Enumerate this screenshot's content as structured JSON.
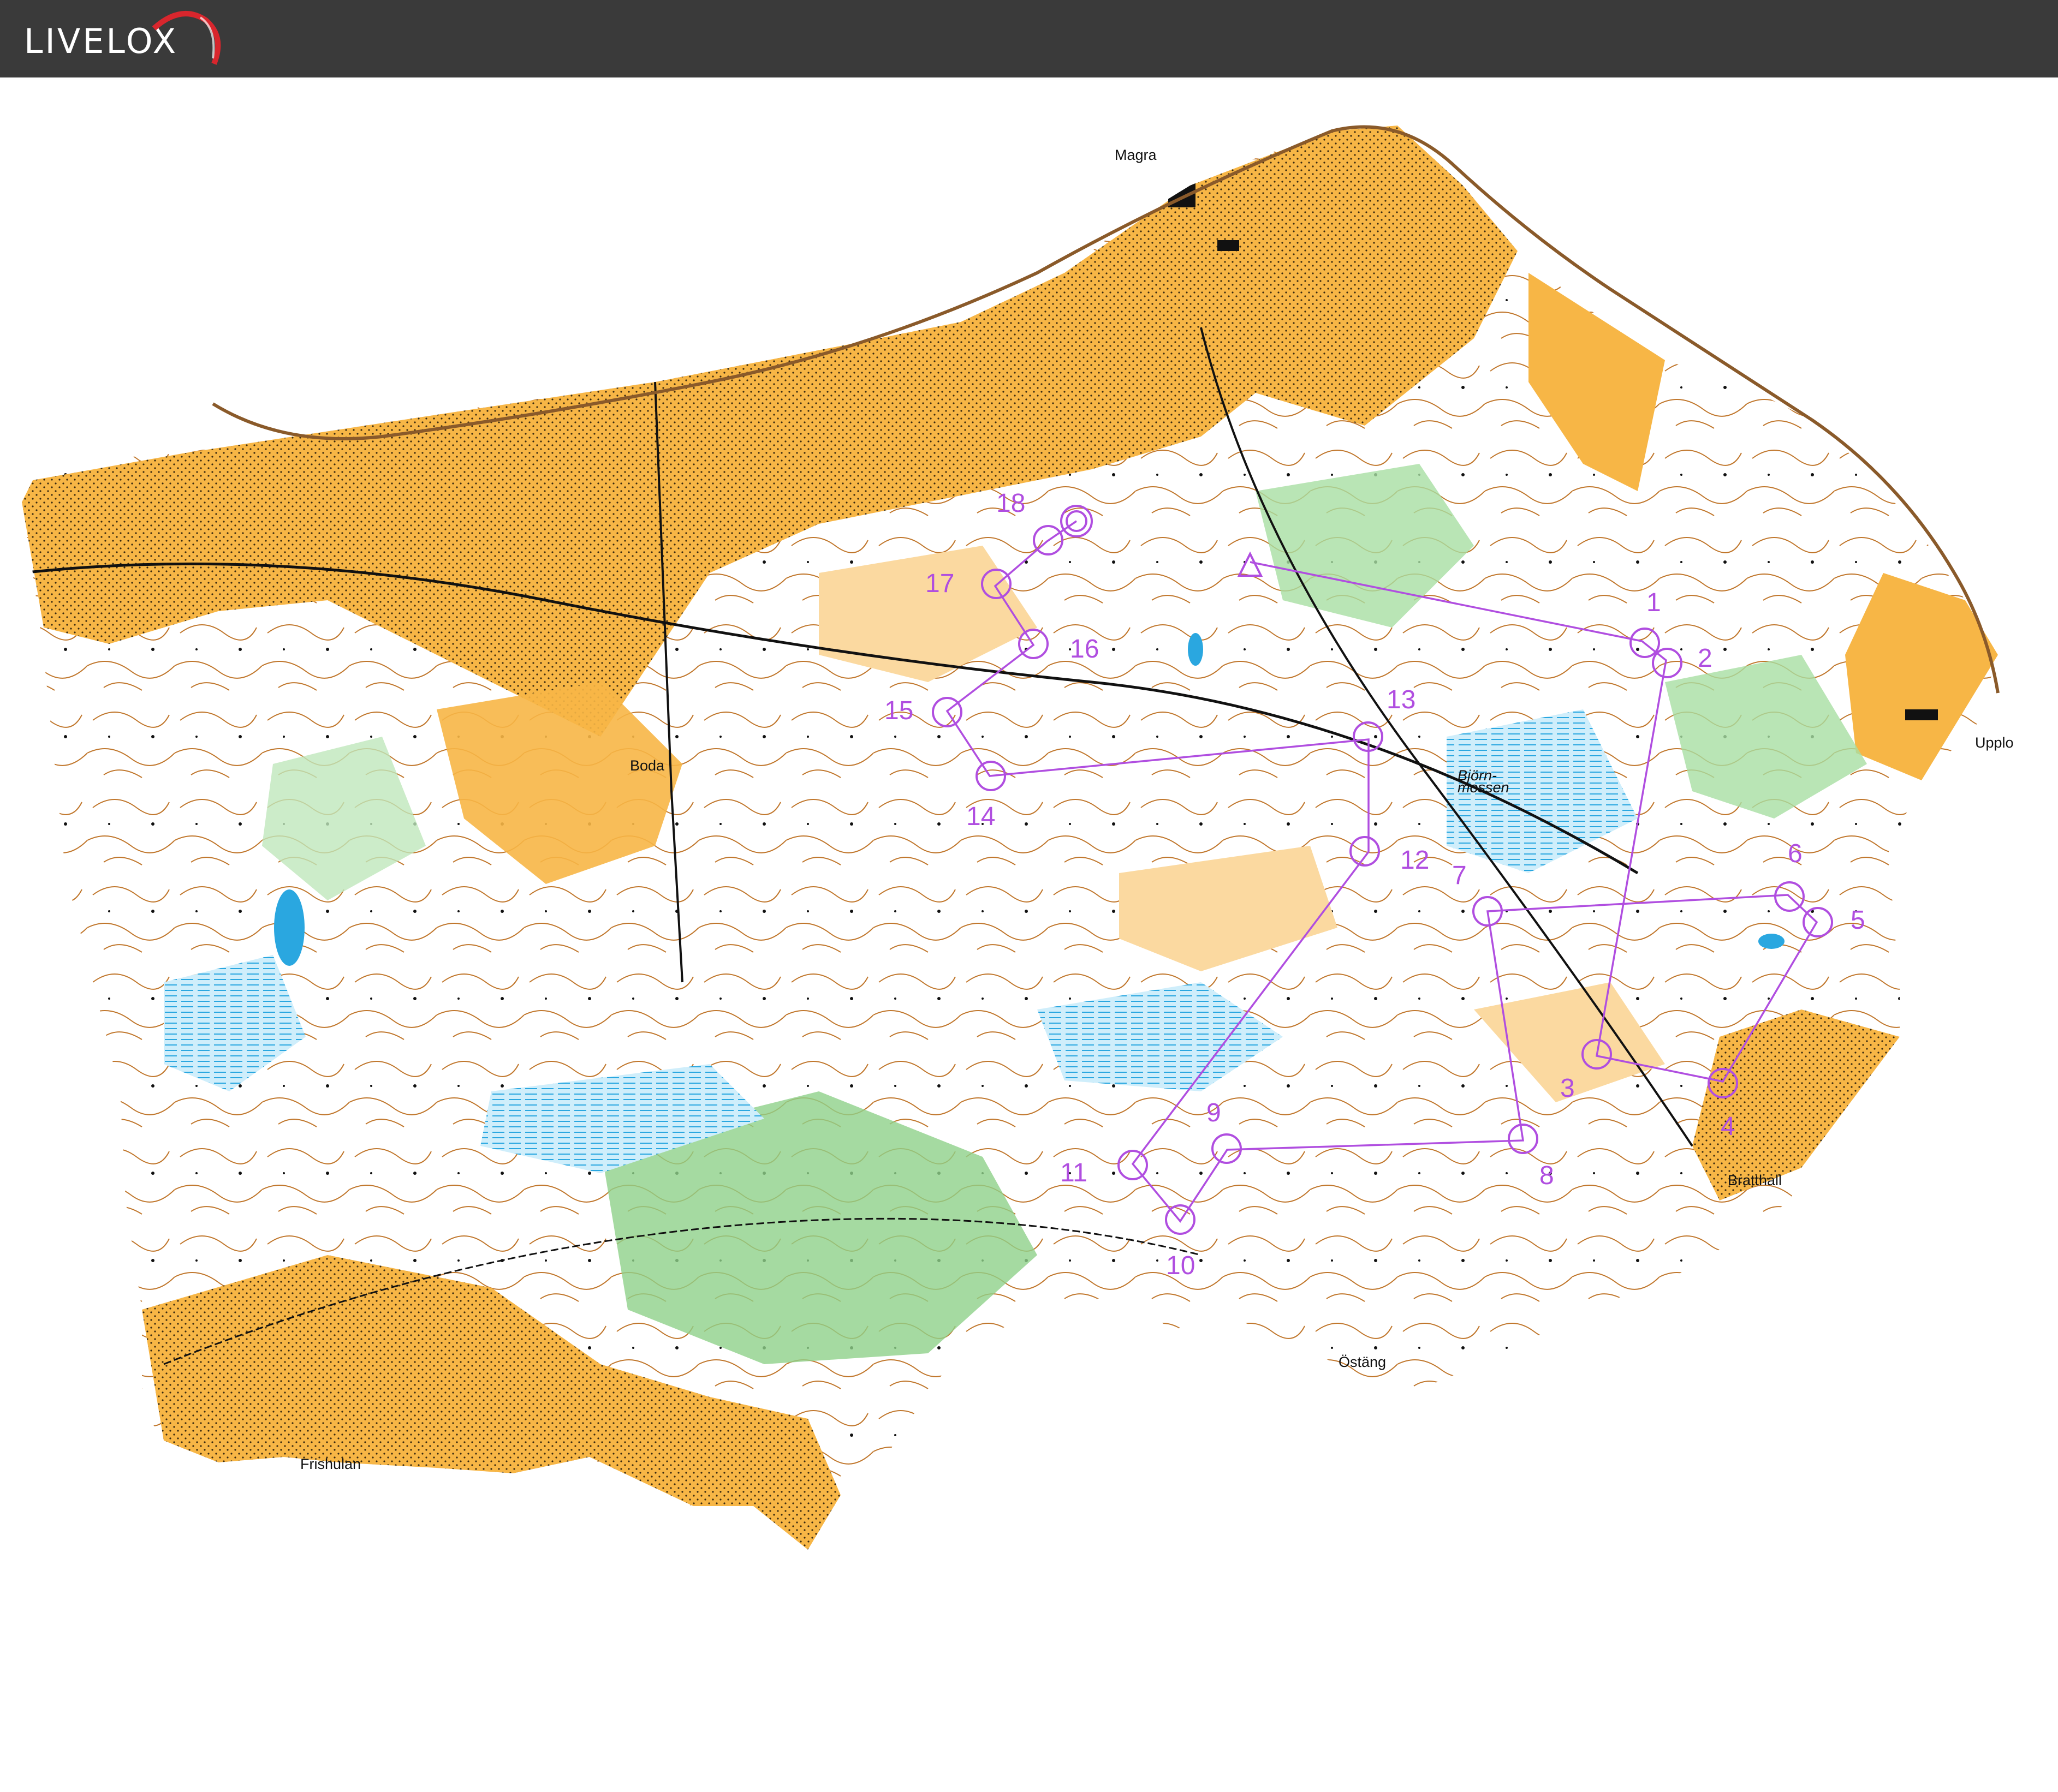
{
  "app": {
    "name": "LIVELOX",
    "accent_color": "#d8262d"
  },
  "map": {
    "place_names": {
      "magra": "Magra",
      "boda": "Boda",
      "upplo": "Upplo",
      "bratthall": "Bratthall",
      "ostang": "Östäng",
      "frishulan": "Frishulan",
      "bjornmossen": "Björn-\nmossen"
    },
    "course": {
      "color": "#b04ee0",
      "start": "start-triangle",
      "finish": "finish-double-circle",
      "control_labels": [
        "1",
        "2",
        "3",
        "4",
        "5",
        "6",
        "7",
        "8",
        "9",
        "10",
        "11",
        "12",
        "13",
        "14",
        "15",
        "16",
        "17",
        "18"
      ]
    }
  }
}
